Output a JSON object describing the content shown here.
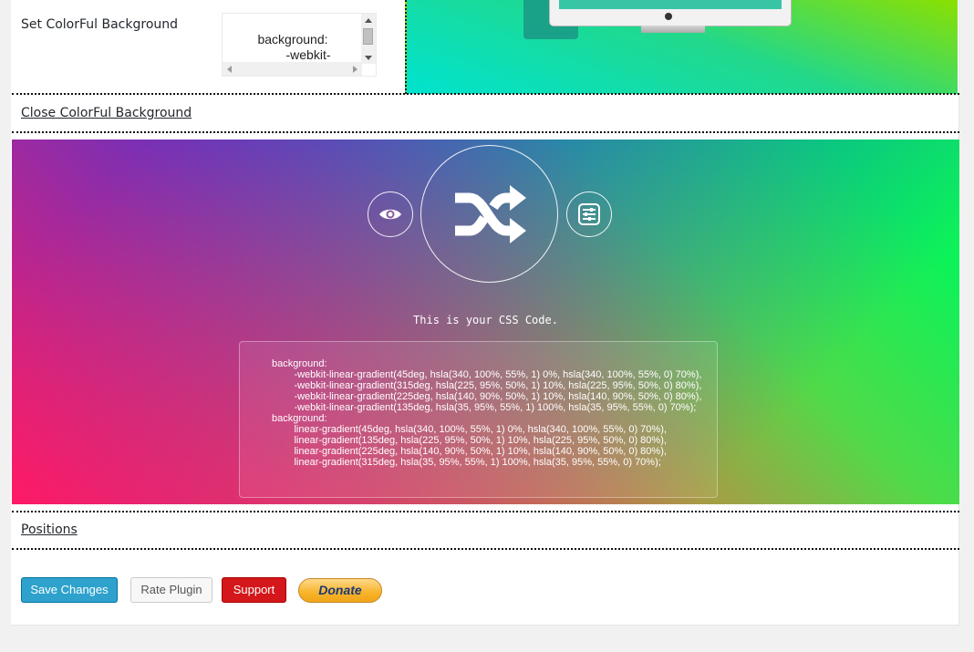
{
  "settings": {
    "set_background_label": "Set ColorFul Background",
    "code_preview_lines": [
      "background:",
      "-webkit-"
    ],
    "close_background_link": "Close ColorFul Background",
    "positions_link": "Positions"
  },
  "generator": {
    "icons": [
      "eye-icon",
      "shuffle-icon",
      "sliders-icon"
    ],
    "caption": "This is your CSS Code.",
    "css_lines": [
      "background:",
      "        -webkit-linear-gradient(45deg, hsla(340, 100%, 55%, 1) 0%, hsla(340, 100%, 55%, 0) 70%),",
      "        -webkit-linear-gradient(315deg, hsla(225, 95%, 50%, 1) 10%, hsla(225, 95%, 50%, 0) 80%),",
      "        -webkit-linear-gradient(225deg, hsla(140, 90%, 50%, 1) 10%, hsla(140, 90%, 50%, 0) 80%),",
      "        -webkit-linear-gradient(135deg, hsla(35, 95%, 55%, 1) 100%, hsla(35, 95%, 55%, 0) 70%);",
      "background:",
      "        linear-gradient(45deg, hsla(340, 100%, 55%, 1) 0%, hsla(340, 100%, 55%, 0) 70%),",
      "        linear-gradient(135deg, hsla(225, 95%, 50%, 1) 10%, hsla(225, 95%, 50%, 0) 80%),",
      "        linear-gradient(225deg, hsla(140, 90%, 50%, 1) 10%, hsla(140, 90%, 50%, 0) 80%),",
      "        linear-gradient(315deg, hsla(35, 95%, 55%, 1) 100%, hsla(35, 95%, 55%, 0) 70%);"
    ]
  },
  "actions": {
    "save": "Save Changes",
    "rate": "Rate Plugin",
    "support": "Support",
    "donate": "Donate"
  },
  "colors": {
    "save_button": "#2ea2cc",
    "support_button": "#d3171a",
    "donate_button": "#f8b42a"
  }
}
